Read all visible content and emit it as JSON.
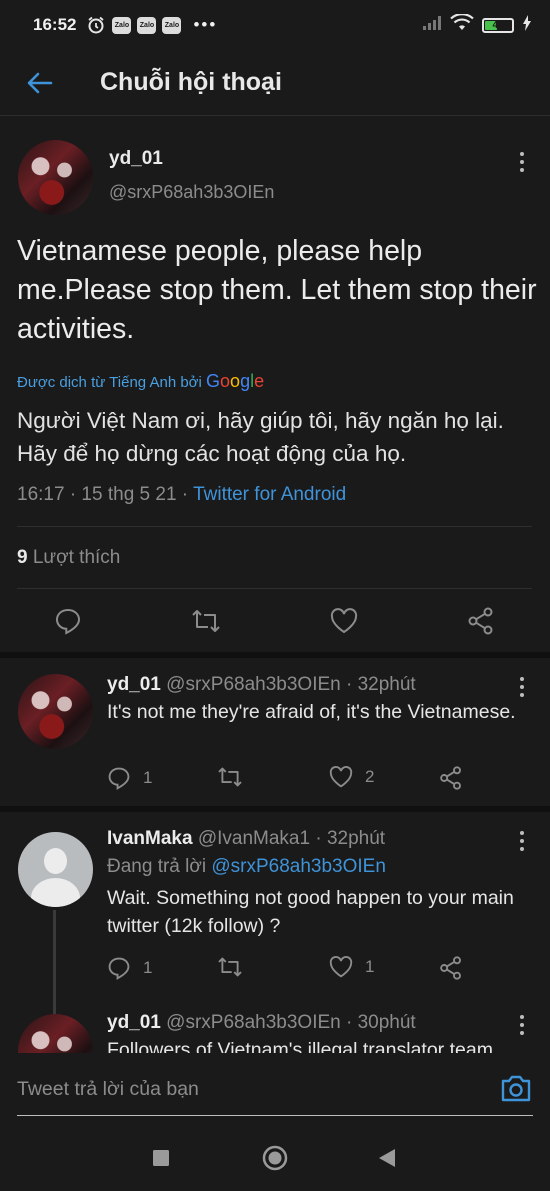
{
  "status_bar": {
    "time": "16:52",
    "notifications": [
      "alarm-icon",
      "Zalo",
      "Zalo",
      "Zalo"
    ],
    "zalo_label": "Zalo",
    "more": "•••",
    "battery": "44"
  },
  "header": {
    "title": "Chuỗi hội thoại"
  },
  "main_tweet": {
    "name": "yd_01",
    "handle": "@srxP68ah3b3OIEn",
    "text": "Vietnamese people, please help me.Please stop them. Let them stop their activities.",
    "translated_label": "Được dịch từ Tiếng Anh bởi",
    "translator": "Google",
    "translation": "Người Việt Nam ơi, hãy giúp tôi, hãy ngăn họ lại. Hãy để họ dừng các hoạt động của họ.",
    "time": "16:17 · 15 thg 5 21 · ",
    "source": "Twitter for Android",
    "likes_count": "9",
    "likes_label": "Lượt thích"
  },
  "replies": [
    {
      "name": "yd_01",
      "handle_time": "@srxP68ah3b3OIEn · 32phút",
      "text": "It's not me they're afraid of, it's the Vietnamese.",
      "reply_count": "1",
      "retweet_count": "",
      "like_count": "2"
    },
    {
      "name": "IvanMaka",
      "handle_time": "@IvanMaka1 · 32phút",
      "replying_label": "Đang trả lời",
      "replying_to": "@srxP68ah3b3OIEn",
      "text": "Wait. Something not good happen to your main twitter (12k follow) ?",
      "reply_count": "1",
      "retweet_count": "",
      "like_count": "1"
    },
    {
      "name": "yd_01",
      "handle_time": "@srxP68ah3b3OIEn · 30phút",
      "text": "Followers of Vietnam's illegal translator team"
    }
  ],
  "compose": {
    "placeholder": "Tweet trả lời của bạn"
  },
  "colors": {
    "background": "#1a1a1a",
    "accent": "#3f93d8",
    "muted": "#8c8c8c"
  }
}
